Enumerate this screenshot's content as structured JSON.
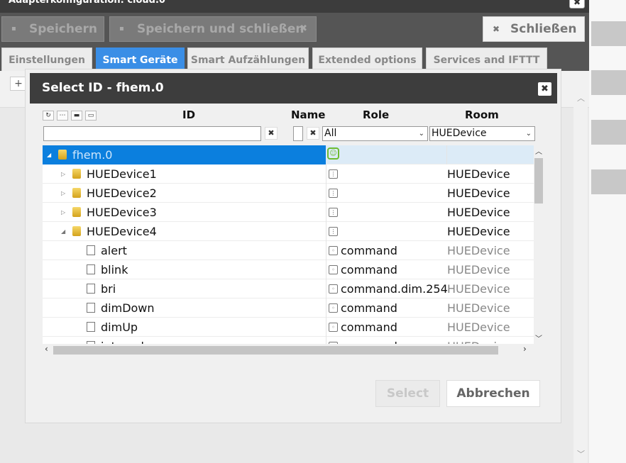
{
  "background": {
    "title": "Adapterkonfiguration: cloud.0",
    "toolbar": {
      "save_label": "Speichern",
      "save_close_label": "Speichern und schließen",
      "close_label": "Schließen"
    },
    "tabs": [
      {
        "label": "Einstellungen",
        "active": false
      },
      {
        "label": "Smart Geräte",
        "active": true
      },
      {
        "label": "Smart Aufzählungen",
        "active": false
      },
      {
        "label": "Extended options",
        "active": false
      },
      {
        "label": "Services and IFTTT",
        "active": false
      }
    ],
    "add_label": "+"
  },
  "dialog": {
    "title": "Select ID - fhem.0",
    "columns": {
      "id": "ID",
      "name": "Name",
      "role": "Role",
      "room": "Room"
    },
    "filters": {
      "id_value": "",
      "name_value": "",
      "role_value": "All",
      "room_value": "HUEDevice"
    },
    "rows": [
      {
        "name": "fhem.0",
        "type": "folder",
        "expanded": true,
        "level": 0,
        "role": "",
        "room": "",
        "selected": true,
        "dim": false
      },
      {
        "name": "HUEDevice1",
        "type": "folder",
        "expanded": false,
        "level": 1,
        "role": "",
        "room": "HUEDevice",
        "selected": false,
        "dim": false
      },
      {
        "name": "HUEDevice2",
        "type": "folder",
        "expanded": false,
        "level": 1,
        "role": "",
        "room": "HUEDevice",
        "selected": false,
        "dim": false
      },
      {
        "name": "HUEDevice3",
        "type": "folder",
        "expanded": false,
        "level": 1,
        "role": "",
        "room": "HUEDevice",
        "selected": false,
        "dim": false
      },
      {
        "name": "HUEDevice4",
        "type": "folder",
        "expanded": true,
        "level": 1,
        "role": "",
        "room": "HUEDevice",
        "selected": false,
        "dim": false
      },
      {
        "name": "alert",
        "type": "state",
        "level": 2,
        "role": "command",
        "room": "HUEDevice",
        "selected": false,
        "dim": true
      },
      {
        "name": "blink",
        "type": "state",
        "level": 2,
        "role": "command",
        "room": "HUEDevice",
        "selected": false,
        "dim": true
      },
      {
        "name": "bri",
        "type": "state",
        "level": 2,
        "role": "command.dim.254",
        "room": "HUEDevice",
        "selected": false,
        "dim": true
      },
      {
        "name": "dimDown",
        "type": "state",
        "level": 2,
        "role": "command",
        "room": "HUEDevice",
        "selected": false,
        "dim": true
      },
      {
        "name": "dimUp",
        "type": "state",
        "level": 2,
        "role": "command",
        "room": "HUEDevice",
        "selected": false,
        "dim": true
      },
      {
        "name": "intervals",
        "type": "state",
        "level": 2,
        "role": "command",
        "room": "HUEDevice",
        "selected": false,
        "dim": true
      }
    ],
    "select_label": "Select",
    "cancel_label": "Abbrechen"
  }
}
